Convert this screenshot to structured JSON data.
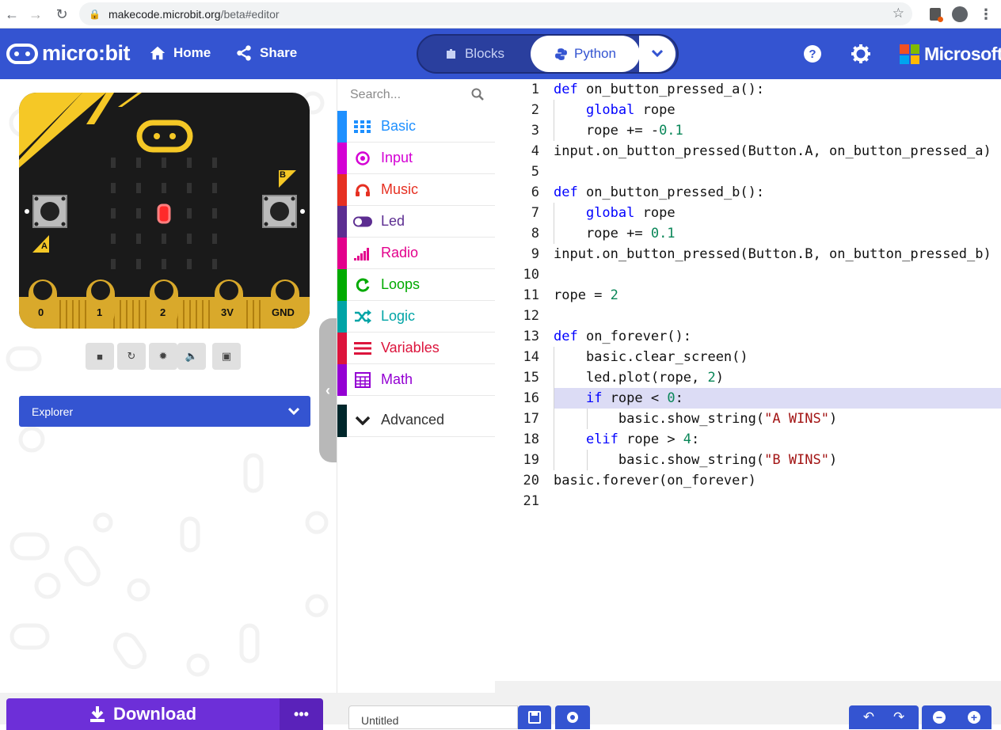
{
  "browser": {
    "url_host": "makecode.microbit.org",
    "url_path": "/beta#editor"
  },
  "header": {
    "logo_text": "micro:bit",
    "home_label": "Home",
    "share_label": "Share",
    "blocks_label": "Blocks",
    "python_label": "Python",
    "microsoft_label": "Microsoft"
  },
  "simulator": {
    "pins": [
      "0",
      "1",
      "2",
      "3V",
      "GND"
    ],
    "button_a": "A",
    "button_b": "B",
    "lit_led": {
      "row": 3,
      "col": 2
    }
  },
  "explorer": {
    "label": "Explorer"
  },
  "toolbox": {
    "search_placeholder": "Search...",
    "categories": [
      {
        "label": "Basic",
        "color": "#1e90ff"
      },
      {
        "label": "Input",
        "color": "#d400d4"
      },
      {
        "label": "Music",
        "color": "#e63022"
      },
      {
        "label": "Led",
        "color": "#5c2d91"
      },
      {
        "label": "Radio",
        "color": "#e3008c"
      },
      {
        "label": "Loops",
        "color": "#00aa00"
      },
      {
        "label": "Logic",
        "color": "#00a4a6"
      },
      {
        "label": "Variables",
        "color": "#dc143c"
      },
      {
        "label": "Math",
        "color": "#9400d3"
      },
      {
        "label": "Advanced",
        "color": "#00272b"
      }
    ]
  },
  "code": {
    "highlight_line": 16,
    "lines": [
      "def on_button_pressed_a():",
      "    global rope",
      "    rope += -0.1",
      "input.on_button_pressed(Button.A, on_button_pressed_a)",
      "",
      "def on_button_pressed_b():",
      "    global rope",
      "    rope += 0.1",
      "input.on_button_pressed(Button.B, on_button_pressed_b)",
      "",
      "rope = 2",
      "",
      "def on_forever():",
      "    basic.clear_screen()",
      "    led.plot(rope, 2)",
      "    if rope < 0:",
      "        basic.show_string(\"A WINS\")",
      "    elif rope > 4:",
      "        basic.show_string(\"B WINS\")",
      "basic.forever(on_forever)",
      ""
    ]
  },
  "bottom": {
    "download_label": "Download",
    "project_name": "Untitled"
  }
}
